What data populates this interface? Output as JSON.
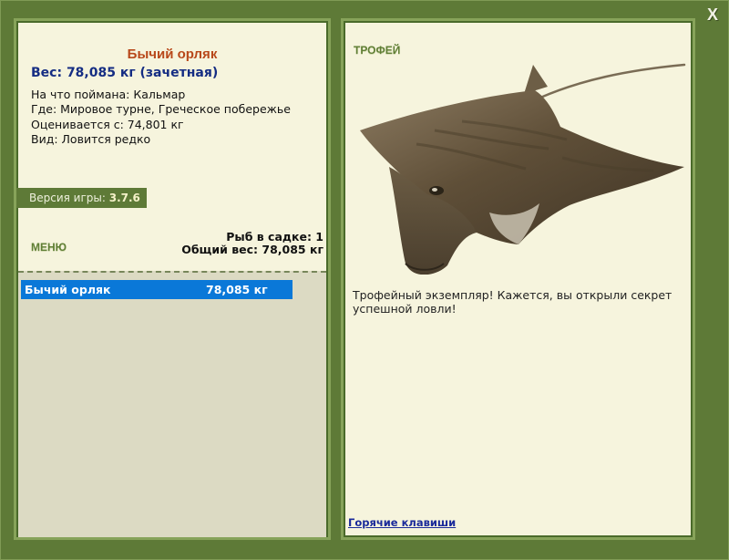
{
  "window": {
    "close_label": "X"
  },
  "fish": {
    "name": "Бычий орляк",
    "weight_line": "Вес: 78,085 кг (зачетная)",
    "bait_line": "На что поймана: Кальмар",
    "location_line": "Где: Мировое турне, Греческое побережье",
    "rated_line": "Оценивается с: 74,801 кг",
    "rarity_line": "Вид: Ловится редко"
  },
  "version": {
    "label": "Версия игры:",
    "value": "3.7.6"
  },
  "menu": {
    "label": "МЕНЮ"
  },
  "keepnet": {
    "count_line": "Рыб в садке: 1",
    "total_line": "Общий вес: 78,085 кг",
    "rows": [
      {
        "name": "Бычий орляк",
        "weight": "78,085 кг"
      }
    ]
  },
  "trophy": {
    "label": "ТРОФЕЙ",
    "image_icon": "eagle-ray-image",
    "text": "Трофейный экземпляр! Кажется, вы открыли секрет успешной ловли!"
  },
  "hotkeys": {
    "label": "Горячие клавиши"
  },
  "colors": {
    "frame": "#5e7a37",
    "panel": "#f6f4dd",
    "fish_name": "#b8481a",
    "weight": "#152d83",
    "selection": "#0a78d8",
    "link": "#1a2a9a"
  }
}
